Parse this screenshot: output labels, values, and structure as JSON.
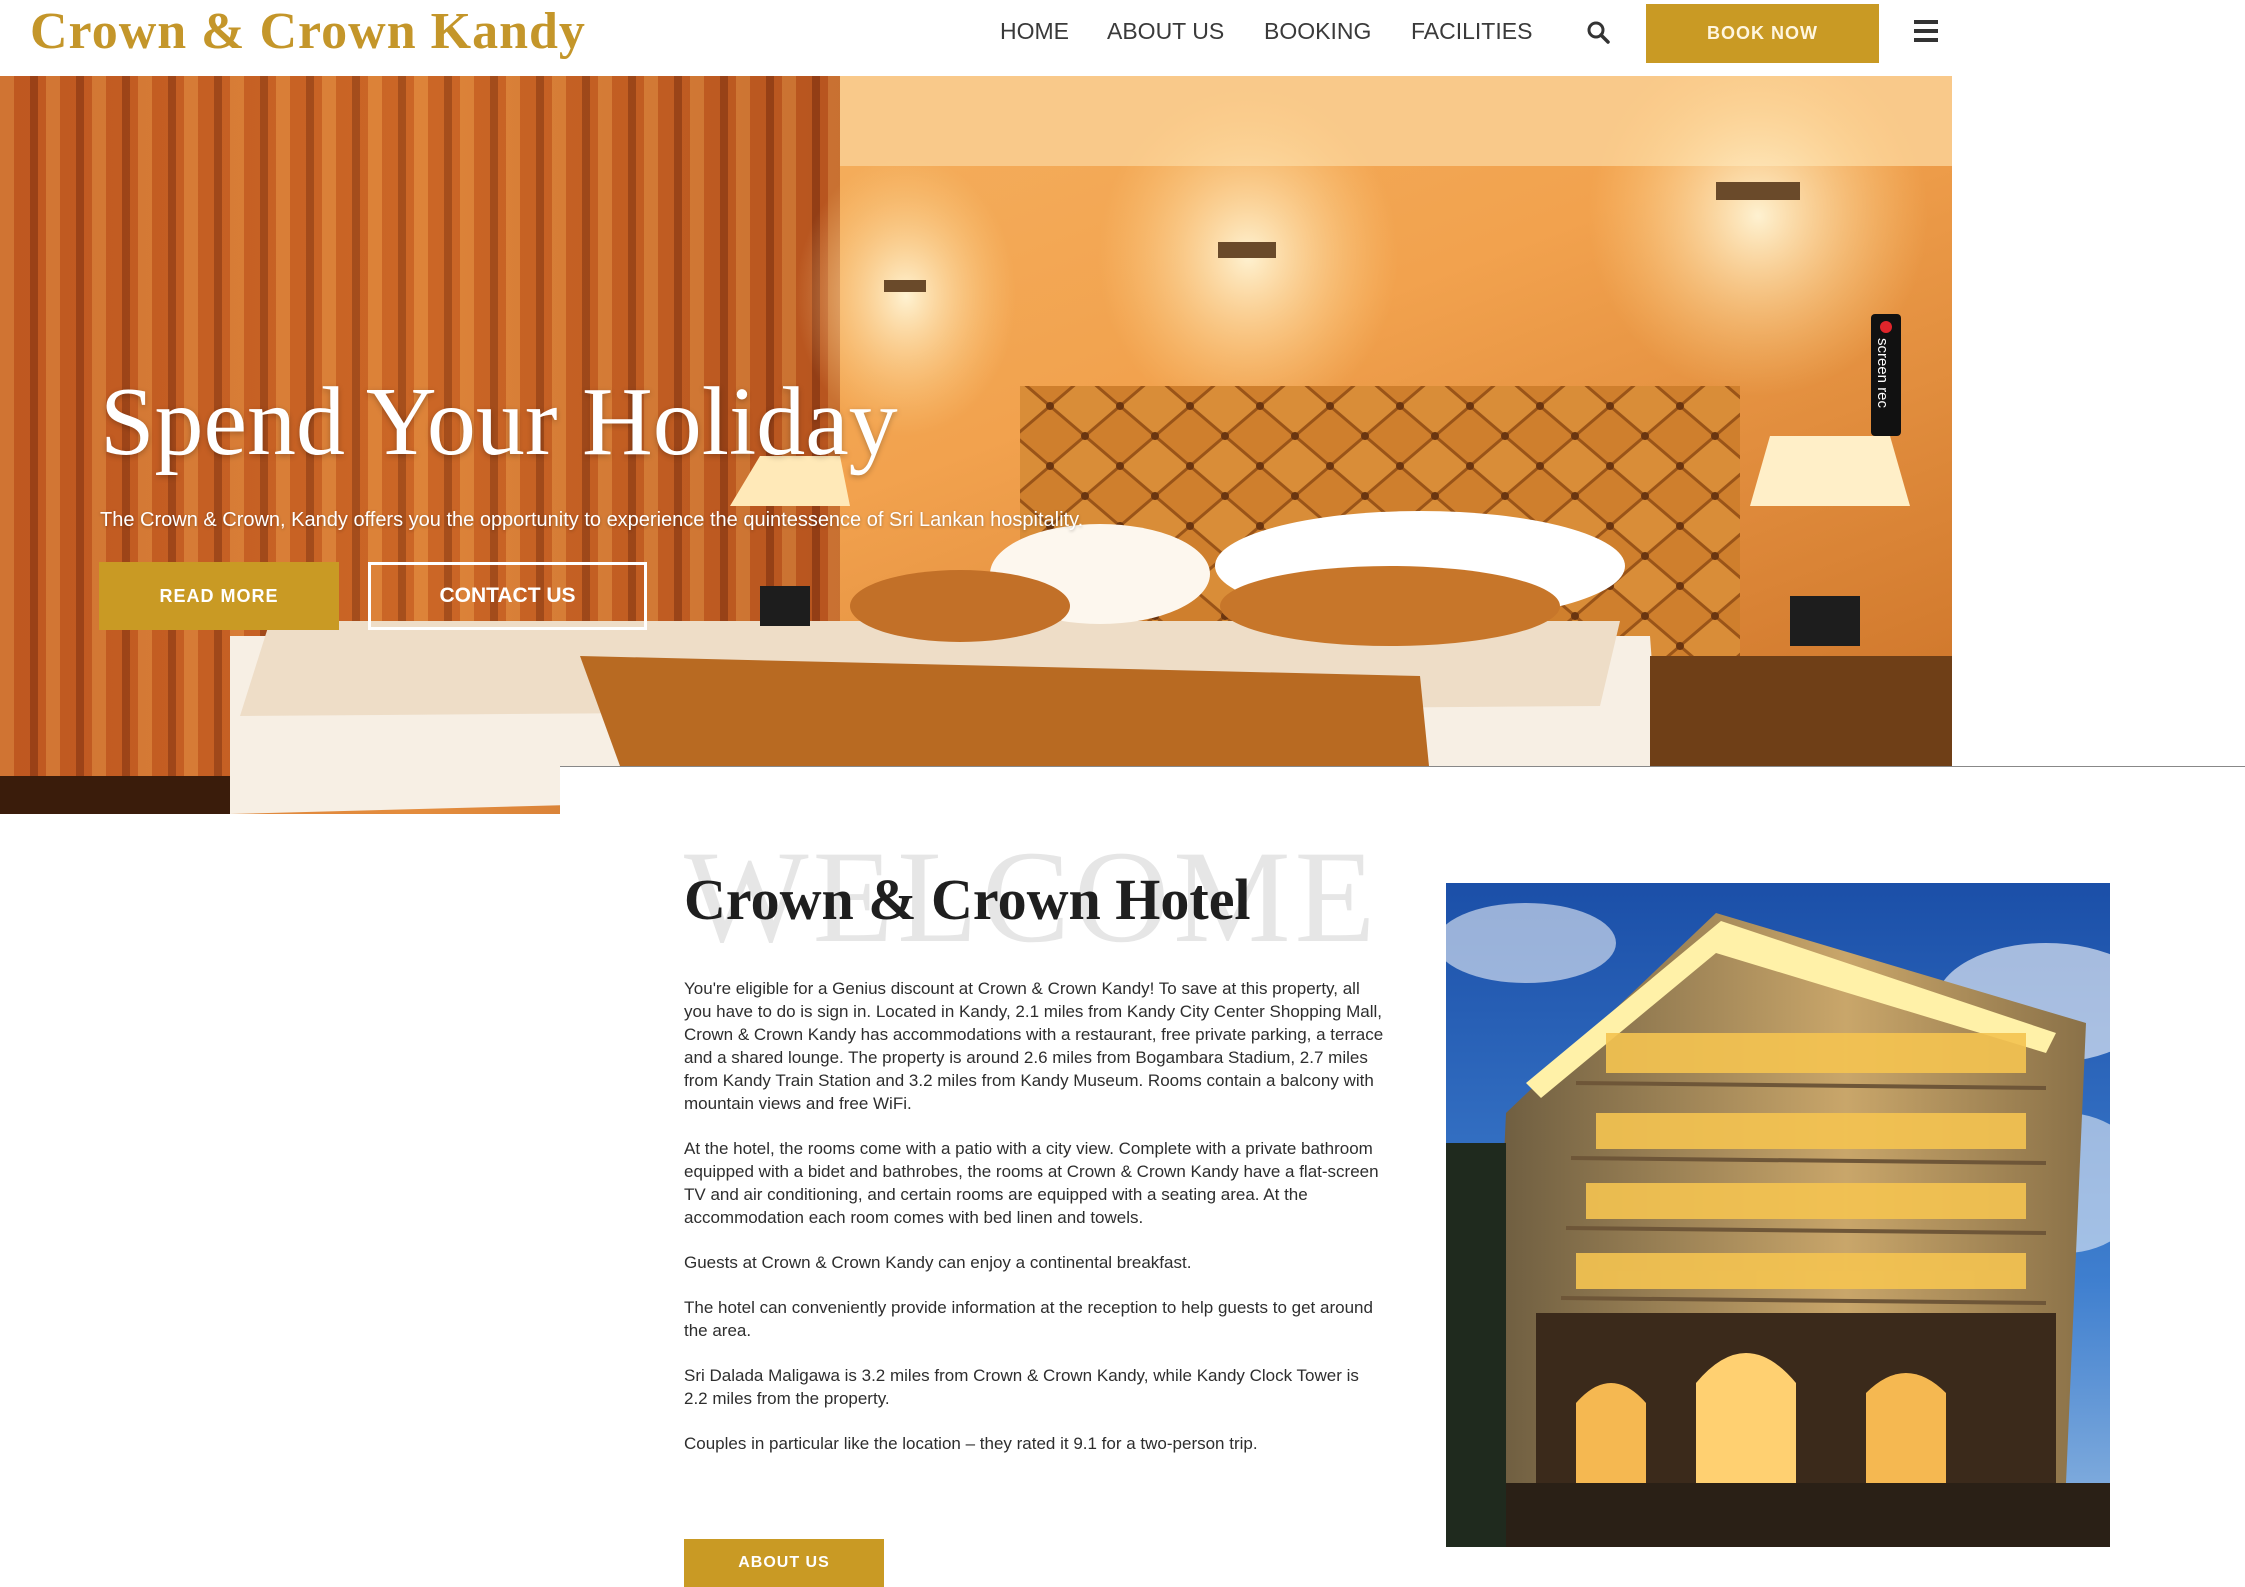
{
  "header": {
    "logo": "Crown & Crown Kandy",
    "nav": {
      "home": "HOME",
      "about": "ABOUT US",
      "booking": "BOOKING",
      "facilities": "FACILITIES"
    },
    "book_now": "BOOK NOW",
    "icons": {
      "search": "search-icon",
      "menu": "hamburger-menu-icon"
    }
  },
  "hero": {
    "title": "Spend Your Holiday",
    "subtitle": "The Crown & Crown, Kandy offers you the opportunity to experience the quintessence of Sri Lankan hospitality.",
    "read_more": "READ MORE",
    "contact_us": "CONTACT US",
    "recorder_badge": "screen rec"
  },
  "welcome": {
    "watermark": "WELCOME",
    "title": "Crown & Crown Hotel",
    "paragraphs": [
      "You're eligible for a Genius discount at Crown & Crown Kandy! To save at this property, all you have to do is sign in. Located in Kandy, 2.1 miles from Kandy City Center Shopping Mall, Crown & Crown Kandy has accommodations with a restaurant, free private parking, a terrace and a shared lounge. The property is around 2.6 miles from Bogambara Stadium, 2.7 miles from Kandy Train Station and 3.2 miles from Kandy Museum. Rooms contain a balcony with mountain views and free WiFi.",
      "At the hotel, the rooms come with a patio with a city view. Complete with a private bathroom equipped with a bidet and bathrobes, the rooms at Crown & Crown Kandy have a flat-screen TV and air conditioning, and certain rooms are equipped with a seating area. At the accommodation each room comes with bed linen and towels.",
      "Guests at Crown & Crown Kandy can enjoy a continental breakfast.",
      "The hotel can conveniently provide information at the reception to help guests to get around the area.",
      "Sri Dalada Maligawa is 3.2 miles from Crown & Crown Kandy, while Kandy Clock Tower is 2.2 miles from the property.",
      "Couples in particular like the location – they rated it 9.1 for a two-person trip."
    ],
    "about_button": "ABOUT US"
  },
  "colors": {
    "brand_gold": "#c99a24",
    "logo_gold": "#c4962a",
    "nav_text": "#3a3a3a"
  }
}
